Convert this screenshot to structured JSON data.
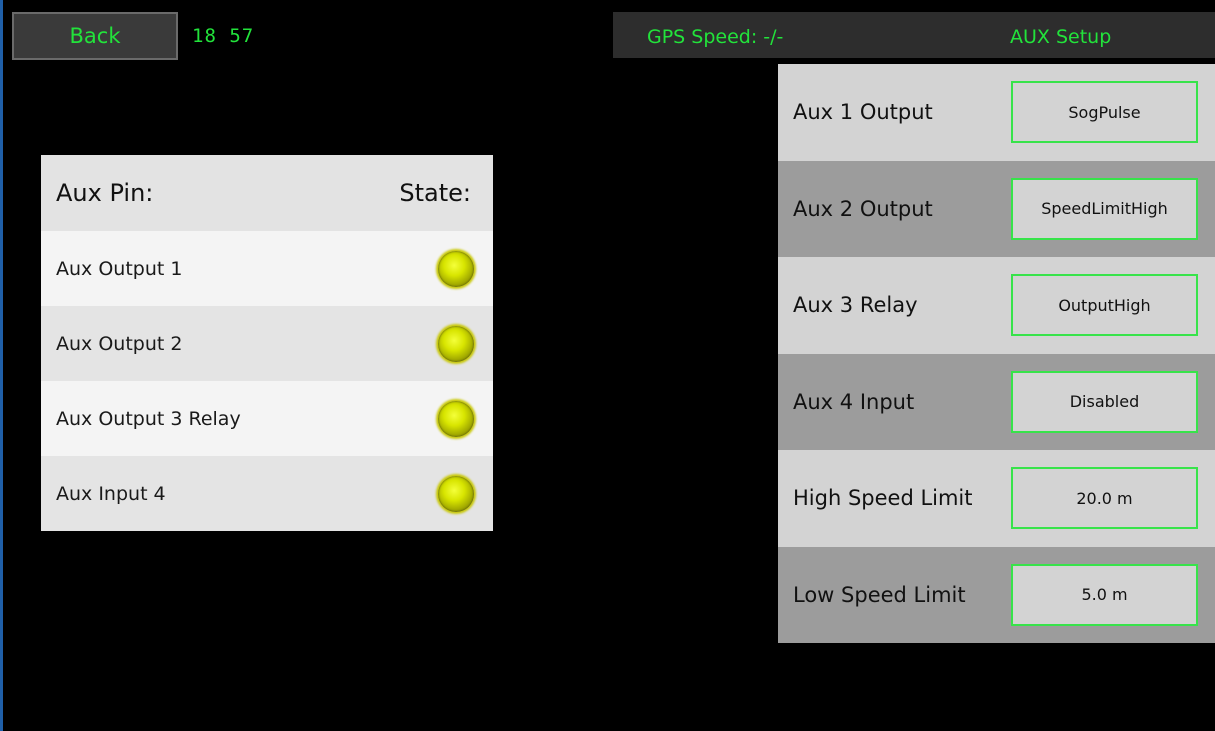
{
  "header": {
    "back_label": "Back",
    "clock": "18 57",
    "gps_speed": "GPS Speed: -/-",
    "title": "AUX Setup"
  },
  "state_table": {
    "pin_header": "Aux Pin:",
    "state_header": "State:",
    "rows": [
      {
        "label": "Aux Output 1",
        "state": "on"
      },
      {
        "label": "Aux Output 2",
        "state": "on"
      },
      {
        "label": "Aux Output 3 Relay",
        "state": "on"
      },
      {
        "label": "Aux Input 4",
        "state": "on"
      }
    ]
  },
  "settings": [
    {
      "label": "Aux 1 Output",
      "value": "SogPulse"
    },
    {
      "label": "Aux 2 Output",
      "value": "SpeedLimitHigh"
    },
    {
      "label": "Aux 3 Relay",
      "value": "OutputHigh"
    },
    {
      "label": "Aux 4 Input",
      "value": "Disabled"
    },
    {
      "label": "High Speed Limit",
      "value": "20.0 m"
    },
    {
      "label": "Low Speed Limit",
      "value": "5.0 m"
    }
  ],
  "colors": {
    "accent_green": "#22e33b",
    "led_yellow": "#d8e500",
    "value_border": "#37e34a"
  }
}
